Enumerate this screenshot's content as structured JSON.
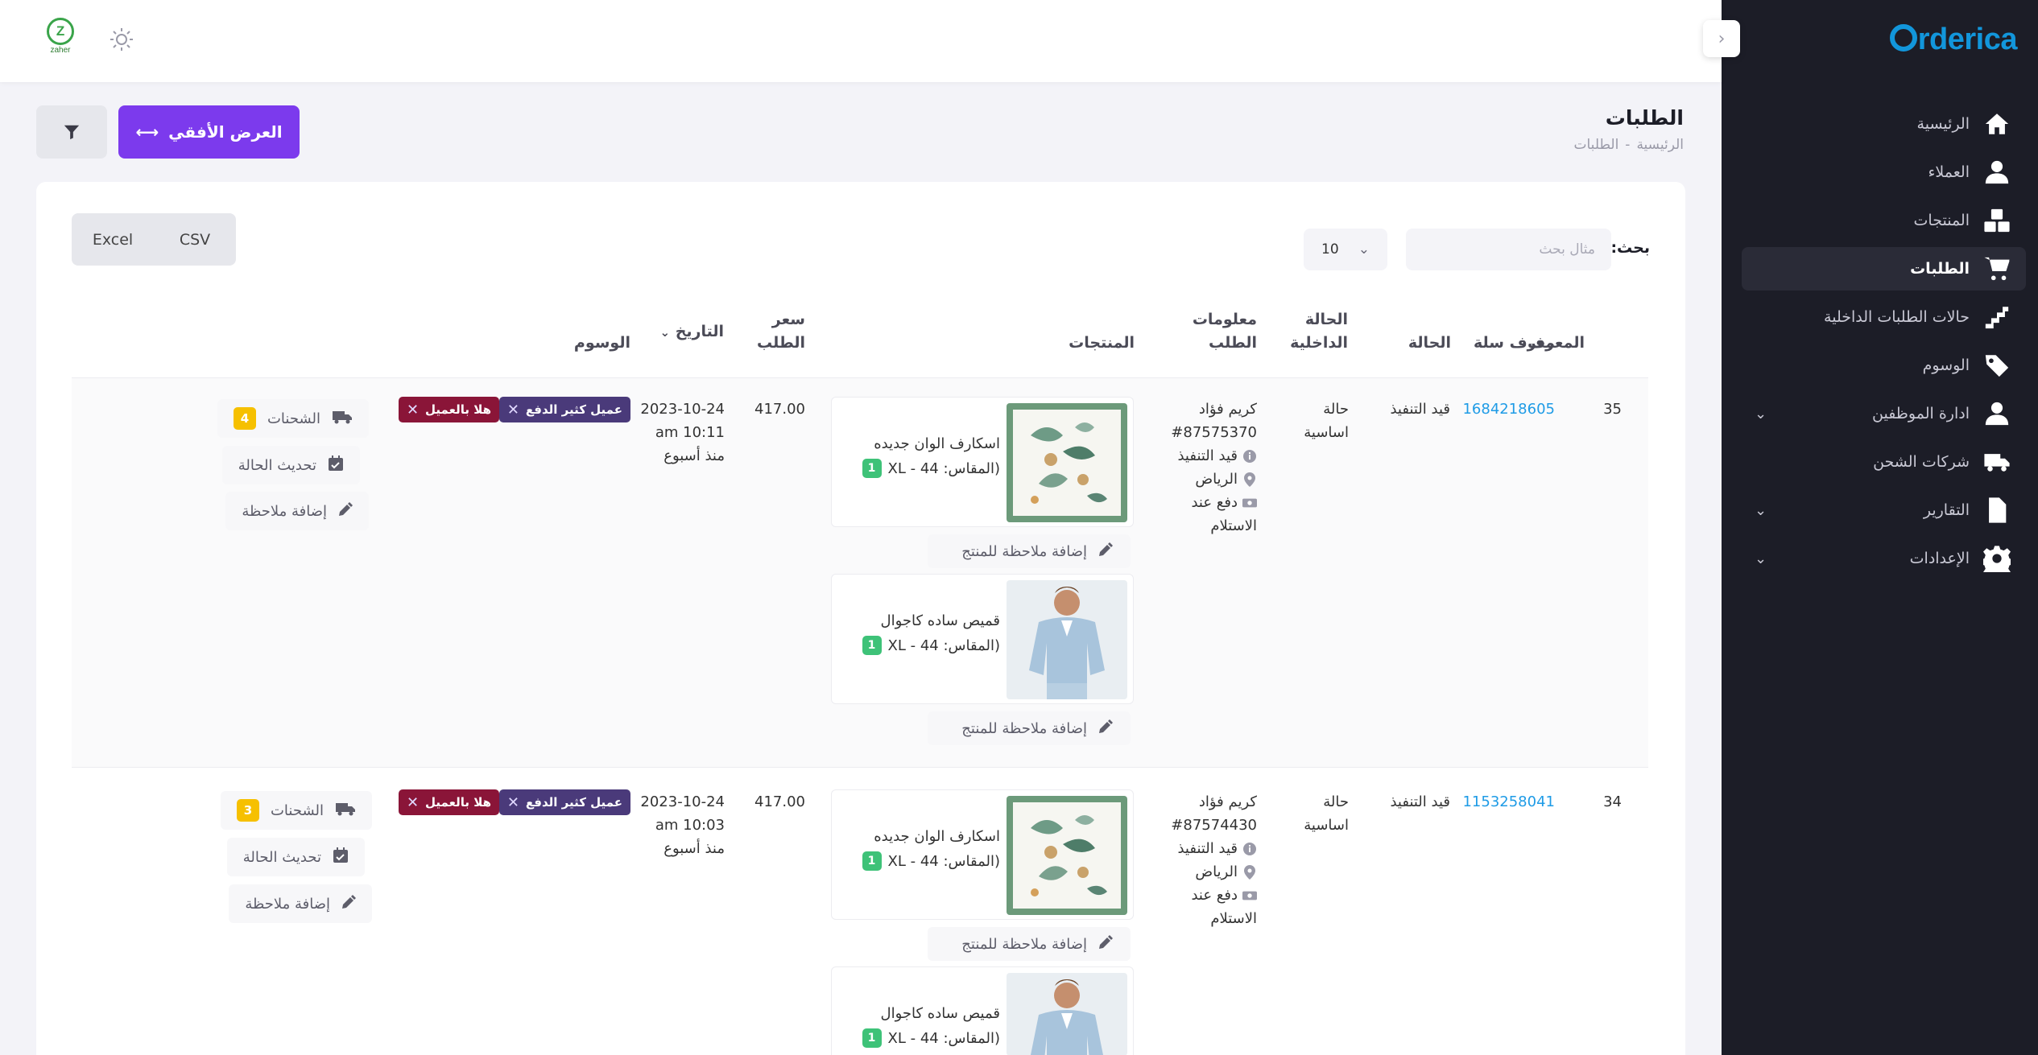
{
  "app": {
    "brand": "rderica",
    "brand_initial": "O"
  },
  "header": {
    "avatar_initial": "Z",
    "avatar_text": "zaher"
  },
  "sidebar": {
    "items": [
      {
        "label": "الرئيسية",
        "icon": "home-icon"
      },
      {
        "label": "العملاء",
        "icon": "user-icon"
      },
      {
        "label": "المنتجات",
        "icon": "boxes-icon"
      },
      {
        "label": "الطلبات",
        "icon": "cart-icon",
        "active": true
      },
      {
        "label": "حالات الطلبات الداخلية",
        "icon": "stairs-icon"
      },
      {
        "label": "الوسوم",
        "icon": "tags-icon"
      },
      {
        "label": "ادارة الموظفين",
        "icon": "user-icon",
        "expandable": true
      },
      {
        "label": "شركات الشحن",
        "icon": "truck-icon"
      },
      {
        "label": "التقارير",
        "icon": "file-icon",
        "expandable": true
      },
      {
        "label": "الإعدادات",
        "icon": "gear-icon",
        "expandable": true
      }
    ]
  },
  "page": {
    "title": "الطلبات",
    "breadcrumb": [
      "الرئيسية",
      "-",
      "الطلبات"
    ],
    "horizontal_view_label": "العرض الأفقي"
  },
  "toolbar": {
    "search_label": "بحث:",
    "search_placeholder": "مثال بحث",
    "page_size": "10",
    "export_csv": "CSV",
    "export_excel": "Excel"
  },
  "table": {
    "headers": {
      "id": "المعرف",
      "cart_id": "معرف سلة",
      "status": "الحالة",
      "internal_status_1": "الحالة",
      "internal_status_2": "الداخلية",
      "order_info_1": "معلومات",
      "order_info_2": "الطلب",
      "products": "المنتجات",
      "price_1": "سعر",
      "price_2": "الطلب",
      "date": "التاريخ",
      "tags": "الوسوم"
    },
    "rows": [
      {
        "id": "35",
        "cart_id": "1684218605",
        "status": "قيد التنفيذ",
        "internal_status_1": "حالة",
        "internal_status_2": "اساسية",
        "customer": "كريم فؤاد",
        "order_no": "#87575370",
        "order_status": "قيد التنفيذ",
        "city": "الرياض",
        "payment_1": "دفع عند",
        "payment_2": "الاستلام",
        "products": [
          {
            "name": "اسكارف الوان جديده",
            "size": "(المقاس: XL - 44",
            "qty": "1",
            "note": "إضافة ملاحظة للمنتج"
          },
          {
            "name": "قميص ساده كاجوال",
            "size": "(المقاس: XL - 44",
            "qty": "1",
            "note": "إضافة ملاحظة للمنتج"
          }
        ],
        "price": "417.00",
        "date": "2023-10-24",
        "time": "10:11 am",
        "ago": "منذ أسبوع",
        "tags": [
          "عميل كثير الدفع",
          "هلا بالعميل"
        ],
        "shipments_label": "الشحنات",
        "shipments_count": "4",
        "update_status": "تحديث الحالة",
        "add_note": "إضافة ملاحظة"
      },
      {
        "id": "34",
        "cart_id": "1153258041",
        "status": "قيد التنفيذ",
        "internal_status_1": "حالة",
        "internal_status_2": "اساسية",
        "customer": "كريم فؤاد",
        "order_no": "#87574430",
        "order_status": "قيد التنفيذ",
        "city": "الرياض",
        "payment_1": "دفع عند",
        "payment_2": "الاستلام",
        "products": [
          {
            "name": "اسكارف الوان جديده",
            "size": "(المقاس: XL - 44",
            "qty": "1",
            "note": "إضافة ملاحظة للمنتج"
          },
          {
            "name": "قميص ساده كاجوال",
            "size": "(المقاس: XL - 44",
            "qty": "1"
          }
        ],
        "price": "417.00",
        "date": "2023-10-24",
        "time": "10:03 am",
        "ago": "منذ أسبوع",
        "tags": [
          "عميل كثير الدفع",
          "هلا بالعميل"
        ],
        "shipments_label": "الشحنات",
        "shipments_count": "3",
        "update_status": "تحديث الحالة",
        "add_note": "إضافة ملاحظة"
      }
    ]
  },
  "colors": {
    "accent": "#7c3aed",
    "sidebar_bg": "#1c1d27",
    "link": "#1e9be6",
    "badge": "#f6c000",
    "qty": "#3ec278"
  }
}
